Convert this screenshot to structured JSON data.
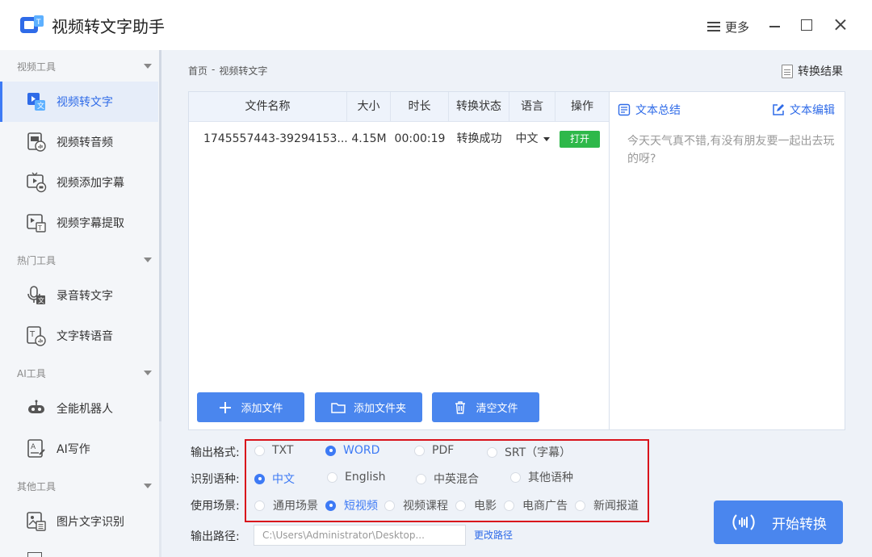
{
  "app": {
    "title": "视频转文字助手",
    "more_label": "更多"
  },
  "sidebar": {
    "sections": [
      {
        "label": "视频工具",
        "items": [
          "视频转文字",
          "视频转音频",
          "视频添加字幕",
          "视频字幕提取"
        ]
      },
      {
        "label": "热门工具",
        "items": [
          "录音转文字",
          "文字转语音"
        ]
      },
      {
        "label": "AI工具",
        "items": [
          "全能机器人",
          "AI写作"
        ]
      },
      {
        "label": "其他工具",
        "items": [
          "图片文字识别"
        ]
      }
    ],
    "active_item": "视频转文字"
  },
  "breadcrumb": {
    "home": "首页",
    "sep": "-",
    "current": "视频转文字"
  },
  "result_link": "转换结果",
  "table": {
    "headers": [
      "文件名称",
      "大小",
      "时长",
      "转换状态",
      "语言",
      "操作"
    ],
    "rows": [
      {
        "name": "1745557443-39294153...",
        "size": "4.15M",
        "duration": "00:00:19",
        "status": "转换成功",
        "language": "中文",
        "action": "打开"
      }
    ]
  },
  "buttons": {
    "add_file": "添加文件",
    "add_folder": "添加文件夹",
    "clear_files": "清空文件",
    "start": "开始转换",
    "change_path": "更改路径"
  },
  "text_panel": {
    "summary_tab": "文本总结",
    "edit_tab": "文本编辑",
    "content": "今天天气真不错,有没有朋友要一起出去玩的呀?"
  },
  "options": {
    "format": {
      "label": "输出格式:",
      "choices": [
        "TXT",
        "WORD",
        "PDF",
        "SRT（字幕）"
      ],
      "selected": "WORD"
    },
    "language": {
      "label": "识别语种:",
      "choices": [
        "中文",
        "English",
        "中英混合",
        "其他语种"
      ],
      "selected": "中文"
    },
    "scene": {
      "label": "使用场景:",
      "choices": [
        "通用场景",
        "短视频",
        "视频课程",
        "电影",
        "电商广告",
        "新闻报道"
      ],
      "selected": "短视频"
    },
    "output_path": {
      "label": "输出路径:",
      "value": "C:\\Users\\Administrator\\Desktop..."
    }
  },
  "colors": {
    "accent": "#3d7af5",
    "button_blue": "#4a86ee",
    "open_green": "#2eb84a",
    "highlight_red": "#d9131b"
  }
}
